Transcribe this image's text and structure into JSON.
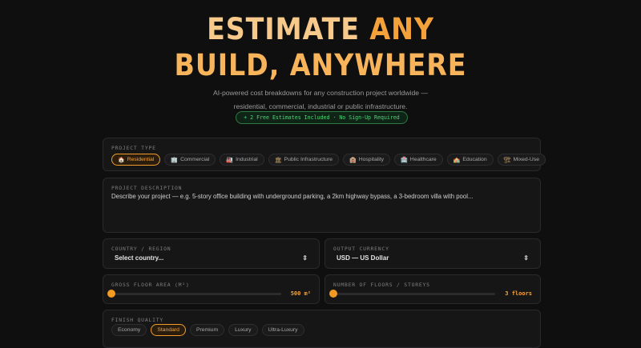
{
  "hero": {
    "title_line1_a": "ESTIMATE",
    "title_line1_b": "ANY",
    "title_line2": "BUILD, ANYWHERE",
    "subtitle_line1": "AI-powered cost breakdowns for any construction project worldwide —",
    "subtitle_line2": "residential, commercial, industrial or public infrastructure.",
    "badge": "+ 2 Free Estimates Included · No Sign-Up Required"
  },
  "project_type": {
    "label": "PROJECT TYPE",
    "options": [
      {
        "label": "Residential",
        "icon": "house-icon",
        "glyph": "🏠",
        "active": true
      },
      {
        "label": "Commercial",
        "icon": "office-building-icon",
        "glyph": "🏢",
        "active": false
      },
      {
        "label": "Industrial",
        "icon": "factory-icon",
        "glyph": "🏭",
        "active": false
      },
      {
        "label": "Public Infrastructure",
        "icon": "infrastructure-icon",
        "glyph": "🏛",
        "active": false
      },
      {
        "label": "Hospitality",
        "icon": "hotel-icon",
        "glyph": "🏨",
        "active": false
      },
      {
        "label": "Healthcare",
        "icon": "hospital-icon",
        "glyph": "🏥",
        "active": false
      },
      {
        "label": "Education",
        "icon": "school-icon",
        "glyph": "🏫",
        "active": false
      },
      {
        "label": "Mixed-Use",
        "icon": "mixed-use-icon",
        "glyph": "🏗",
        "active": false
      }
    ]
  },
  "description": {
    "label": "PROJECT DESCRIPTION",
    "placeholder": "Describe your project — e.g. 5-story office building with underground parking, a 2km highway bypass, a 3-bedroom villa with pool..."
  },
  "country": {
    "label": "COUNTRY / REGION",
    "value": "Select country..."
  },
  "currency": {
    "label": "OUTPUT CURRENCY",
    "value": "USD — US Dollar"
  },
  "floor_area": {
    "label": "GROSS FLOOR AREA (M²)",
    "value_text": "500 m²",
    "fraction": 0.0
  },
  "floors": {
    "label": "NUMBER OF FLOORS / STOREYS",
    "value_text": "3 floors",
    "fraction": 0.0
  },
  "finish": {
    "label": "FINISH QUALITY",
    "options": [
      {
        "label": "Economy",
        "active": false
      },
      {
        "label": "Standard",
        "active": true
      },
      {
        "label": "Premium",
        "active": false
      },
      {
        "label": "Luxury",
        "active": false
      },
      {
        "label": "Ultra-Luxury",
        "active": false
      }
    ]
  },
  "colors": {
    "accent": "#f6a23a",
    "badge_green": "#52d47a",
    "background": "#0f0f10"
  }
}
